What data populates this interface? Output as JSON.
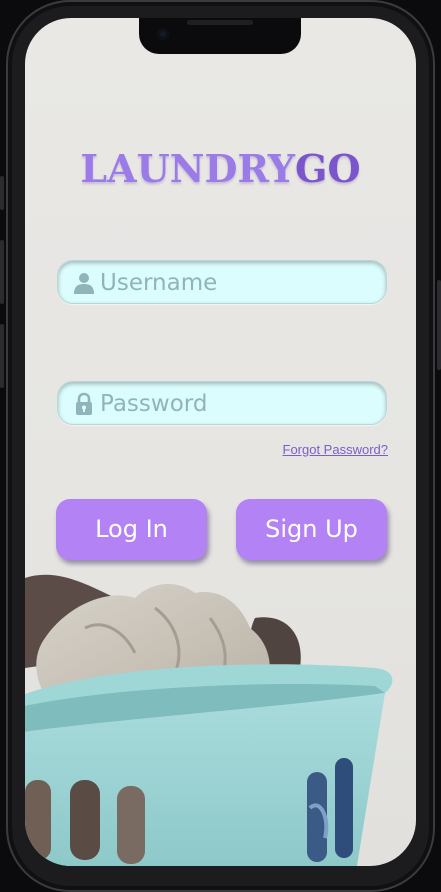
{
  "app": {
    "logo_part1": "LAUNDRY",
    "logo_part2": "GO"
  },
  "login_form": {
    "username_placeholder": "Username",
    "password_placeholder": "Password",
    "forgot_password_label": "Forgot Password?",
    "login_label": "Log In",
    "signup_label": "Sign Up"
  },
  "icons": {
    "username": "person-icon",
    "password": "lock-icon"
  },
  "colors": {
    "logo_primary": "#9b7be8",
    "logo_accent": "#7a55cc",
    "button_bg": "#b382f5",
    "field_bg": "#dcfdfd",
    "placeholder": "#8fb5ba",
    "link": "#7a5fc9"
  }
}
